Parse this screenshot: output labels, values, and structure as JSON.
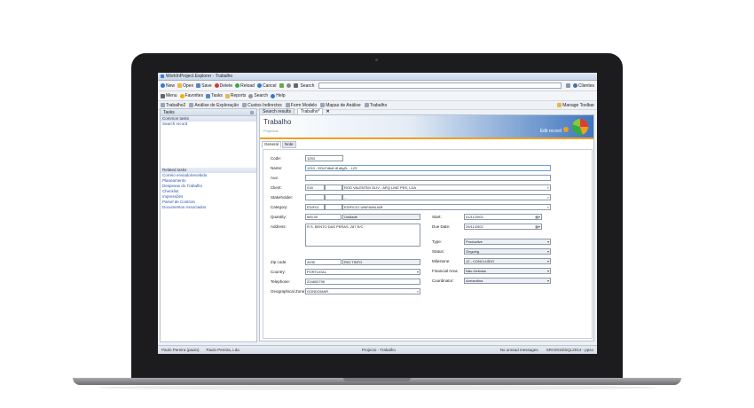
{
  "window": {
    "title": "WorkInProject.Explorer - Trabalho"
  },
  "toolbar1": {
    "new": "New",
    "open": "Open",
    "save": "Save",
    "delete": "Delete",
    "reload": "Reload",
    "cancel": "Cancel",
    "search_label": "Search",
    "user": "Clientes"
  },
  "toolbar2": {
    "menu": "Menu",
    "favorites": "Favorites",
    "tasks": "Tasks",
    "reports": "Reports",
    "search": "Search",
    "help": "Help"
  },
  "toolbar3": {
    "items": [
      "Trabalho2",
      "Análise de Exploração",
      "Custos Indirectos",
      "Form Modelo",
      "Mapas de Análise",
      "Trabalho"
    ],
    "manage": "Manage Toolbar"
  },
  "left_panel": {
    "tab": "Tasks",
    "common_title": "Common tasks",
    "common_items": [
      "Search record"
    ],
    "related_title": "Related tasks",
    "related_items": [
      "Correio enviado/recebido",
      "Planeamento",
      "Despesas do Trabalho",
      "Checklist",
      "Impressões",
      "Painel de Controlo",
      "Documentos Associados"
    ]
  },
  "doc_tabs": {
    "search": "Search results",
    "current": "Trabalho*"
  },
  "header": {
    "title": "Trabalho",
    "subtitle": "Projectos",
    "edit": "Edit record"
  },
  "subtabs": {
    "general": "General",
    "note": "Note"
  },
  "form": {
    "code_label": "Code:",
    "code": "1253",
    "name_label": "Name:",
    "name": "1210 - EDLFdbdf df dfgZL - L23",
    "aux_label": "Aux:",
    "aux": "",
    "client_label": "Client:",
    "client_code": "018",
    "client_name": "ROD VALENTIM OLIV - ARQ LINE PES, LDA",
    "stakeholder_label": "Stakeholder:",
    "stakeholder": "...",
    "category_label": "Category:",
    "category_code": "EDIF01",
    "category_name": "EDIFICIO UNIFAMILIAR",
    "quantity_label": "Quantity:",
    "quantity": "665.00",
    "unit": "Unidade",
    "address_label": "Address:",
    "address": "R S. BENTO DAS PERAS, 287 R/C",
    "zip_label": "Zip code:",
    "zip": "4435",
    "city": "RIO TINTO",
    "country_label": "Country:",
    "country": "PORTUGAL",
    "telephone_label": "Telephone:",
    "telephone": "224800795",
    "geo_label": "Geographical Zone:",
    "geo": "GONDOMAR",
    "start_label": "Start:",
    "start": "01/11/2002",
    "due_label": "Due Date:",
    "due": "29/11/2002",
    "type_label": "Type:",
    "type": "Productive",
    "status_label": "Status:",
    "status": "Ongoing",
    "milestone_label": "Milestone:",
    "milestone": "12 - CONCLUÍDO",
    "financial_label": "Financial Area:",
    "financial": "Não Definido",
    "coordinator_label": "Coordinator:",
    "coordinator": "Armandina"
  },
  "statusbar": {
    "user": "Paulo Pereira (paulo)",
    "company": "Paulo Pereira, Lda",
    "context": "Projecto - Trabalho",
    "messages": "No unread messages.",
    "server": "SRV2016\\SQL2014 - ppso"
  },
  "colors": {
    "accent": "#3f76bf",
    "highlight": "#f0a01e",
    "link": "#2a55a8"
  }
}
